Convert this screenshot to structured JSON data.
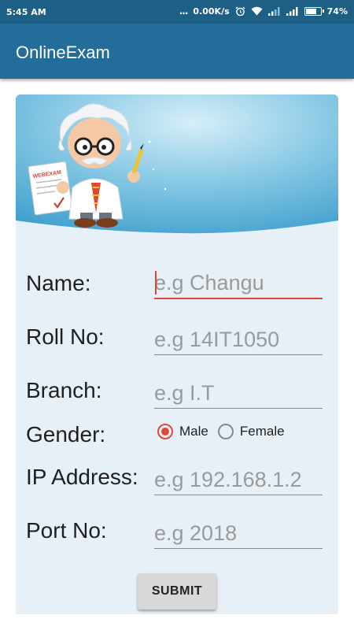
{
  "status_bar": {
    "time": "5:45 AM",
    "dots": "...",
    "network_speed": "0.00K/s",
    "battery_percent": "74%",
    "battery_level": 0.74,
    "icons": [
      "alarm-icon",
      "wifi-icon",
      "signal-icon",
      "signal-icon",
      "battery-icon"
    ]
  },
  "app_bar": {
    "title": "OnlineExam"
  },
  "banner": {
    "logo_text": "WEBEXAM",
    "colors": {
      "sky_top": "#bfe2f2",
      "sky_bottom": "#4aa8d2"
    }
  },
  "form": {
    "name": {
      "label": "Name:",
      "placeholder": "e.g Changu"
    },
    "roll": {
      "label": "Roll No:",
      "placeholder": "e.g 14IT1050"
    },
    "branch": {
      "label": "Branch:",
      "placeholder": "e.g I.T"
    },
    "gender": {
      "label": "Gender:",
      "options": [
        {
          "label": "Male",
          "checked": true
        },
        {
          "label": "Female",
          "checked": false
        }
      ]
    },
    "ip": {
      "label": "IP Address:",
      "placeholder": "e.g 192.168.1.2"
    },
    "port": {
      "label": "Port No:",
      "placeholder": "e.g 2018"
    },
    "submit_label": "SUBMIT"
  },
  "colors": {
    "status_bar": "#1e5f86",
    "app_bar": "#236d9b",
    "card_bg": "#e8f0f7",
    "accent": "#e0473b"
  }
}
